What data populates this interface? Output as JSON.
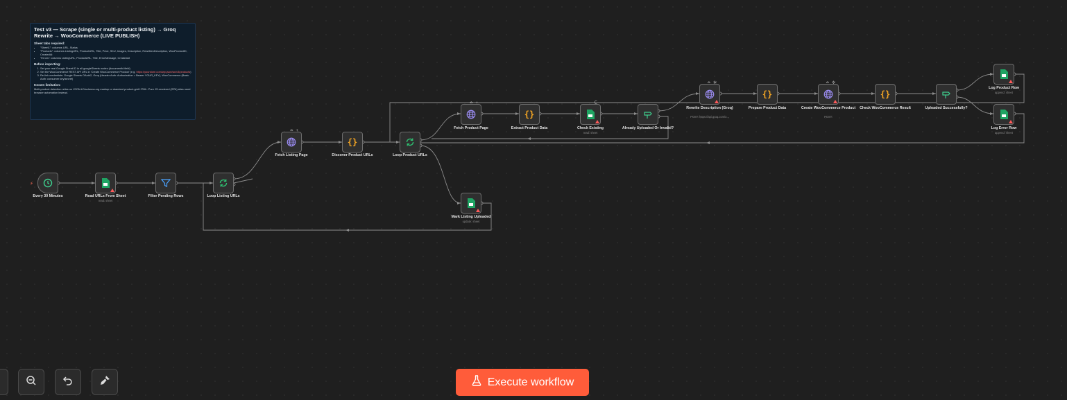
{
  "note": {
    "title": "Test v3 — Scrape (single or multi-product listing) → Groq Rewrite → WooCommerce (LIVE PUBLISH)",
    "sheet_tabs_heading": "Sheet tabs required:",
    "sheet_tabs": [
      "\"Sheet1\": columns URL, Status",
      "\"Products\": columns ListingURL, ProductURL, Title, Price, SKU, Images, Description, RewrittenDescription, WooProductID, CreatedAt",
      "\"Errors\": columns ListingURL, ProductURL, Title, ErrorMessage, CreatedAt"
    ],
    "before_heading": "Before importing:",
    "before_steps": [
      "Set your real Google Sheet ID in all googleSheets nodes (documentId field)",
      "Set the WooCommerce REST API URL in 'Create WooCommerce Product' (e.g. ",
      "Re-link credentials: Google Sheets OAuth2, Groq (Header Auth: Authorization = Bearer YOUR_KEY), WooCommerce (Basic Auth: consumer key/secret)"
    ],
    "before_step2_link": "https://yourstore.com/wp-json/wc/v3/products",
    "before_step2_tail": ")",
    "limitation_heading": "Known limitation:",
    "limitation_text": "Multi-product detection relies on JSON-LD/schema.org markup or standard product-grid HTML. Pure JS-rendered (SPA) sites need browser automation instead."
  },
  "nodes": {
    "every30": {
      "label": "Every 30 Minutes",
      "icon": "clock-icon"
    },
    "readUrls": {
      "label": "Read URLs From Sheet",
      "sub": "read: sheet",
      "icon": "google-sheets-icon"
    },
    "filterPending": {
      "label": "Filter Pending Rows",
      "icon": "filter-icon"
    },
    "loopListing": {
      "label": "Loop Listing URLs",
      "icon": "loop-icon"
    },
    "fetchListing": {
      "label": "Fetch Listing Page",
      "icon": "globe-icon"
    },
    "discover": {
      "label": "Discover Product URLs",
      "icon": "code-icon"
    },
    "loopProduct": {
      "label": "Loop Product URLs",
      "icon": "loop-icon"
    },
    "fetchProduct": {
      "label": "Fetch Product Page",
      "icon": "globe-icon"
    },
    "extract": {
      "label": "Extract Product Data",
      "icon": "code-icon"
    },
    "checkExisting": {
      "label": "Check Existing",
      "sub": "read: sheet",
      "icon": "google-sheets-icon"
    },
    "alreadyUploaded": {
      "label": "Already Uploaded Or Invalid?",
      "icon": "if-icon"
    },
    "rewrite": {
      "label": "Rewrite Description (Groq)",
      "sub": "POST: https://api.groq.com/o...",
      "icon": "globe-icon"
    },
    "prepare": {
      "label": "Prepare Product Data",
      "icon": "code-icon"
    },
    "createWoo": {
      "label": "Create WooCommerce Product",
      "sub": "POST:",
      "icon": "globe-icon"
    },
    "checkWoo": {
      "label": "Check WooCommerce Result",
      "icon": "code-icon"
    },
    "uploaded": {
      "label": "Uploaded Successfully?",
      "icon": "if-icon"
    },
    "logProduct": {
      "label": "Log Product Row",
      "sub": "append: sheet",
      "icon": "google-sheets-icon"
    },
    "logError": {
      "label": "Log Error Row",
      "sub": "append: sheet",
      "icon": "google-sheets-icon"
    },
    "markListing": {
      "label": "Mark Listing Uploaded",
      "sub": "update: sheet",
      "icon": "google-sheets-icon"
    }
  },
  "toolbar": {
    "zoom_out_icon": "zoom-out-icon",
    "undo_icon": "undo-icon",
    "tidy_icon": "broom-icon",
    "execute_label": "Execute workflow"
  },
  "colors": {
    "canvas": "#1f1f1f",
    "accent": "#ff5c3a",
    "warning": "#ff5b5b",
    "sheets": "#1fa463",
    "http": "#8c7ae6",
    "code": "#f5a623",
    "if": "#3ecf8e",
    "loop": "#2fbf71"
  }
}
